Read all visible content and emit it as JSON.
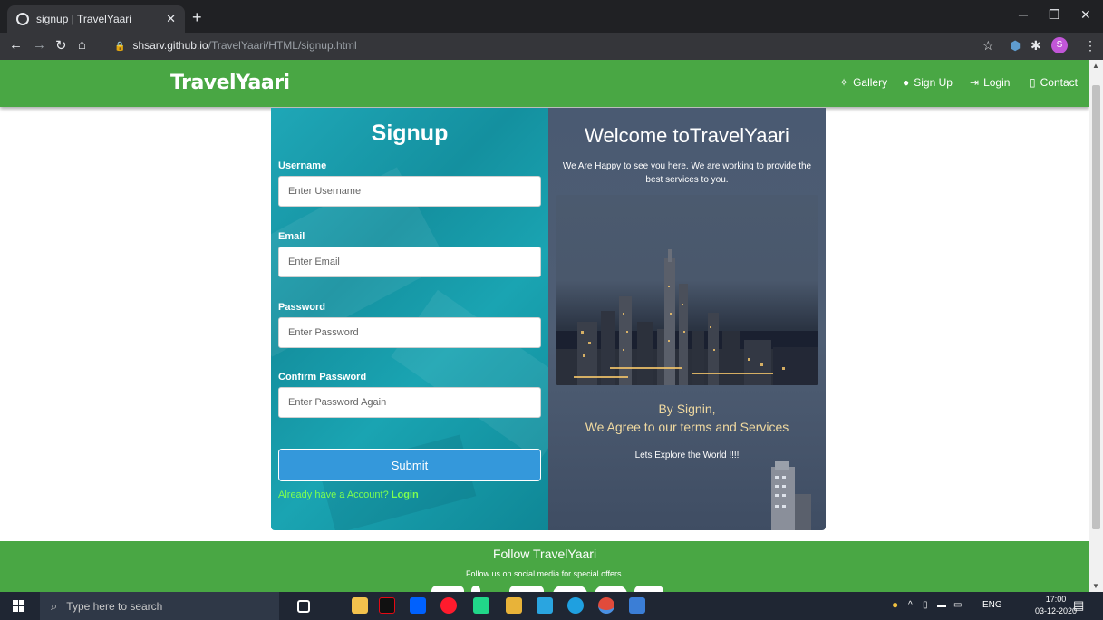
{
  "browser": {
    "tab_title": "signup | TravelYaari",
    "url_host": "shsarv.github.io",
    "url_path": "/TravelYaari/HTML/signup.html",
    "profile_initial": "S"
  },
  "site": {
    "brand": "TravelYaari",
    "nav": [
      {
        "label": "Gallery",
        "icon": "gallery-icon"
      },
      {
        "label": "Sign Up",
        "icon": "user-icon"
      },
      {
        "label": "Login",
        "icon": "login-icon"
      },
      {
        "label": "Contact",
        "icon": "phone-icon"
      }
    ]
  },
  "signup": {
    "title": "Signup",
    "username_label": "Username",
    "username_placeholder": "Enter Username",
    "email_label": "Email",
    "email_placeholder": "Enter Email",
    "password_label": "Password",
    "password_placeholder": "Enter Password",
    "confirm_label": "Confirm Password",
    "confirm_placeholder": "Enter Password Again",
    "submit_label": "Submit",
    "have_account_text": "Already have a Account?",
    "login_link": "Login"
  },
  "welcome": {
    "title": "Welcome toTravelYaari",
    "text": "We Are Happy to see you here. We are working to provide the best services to you.",
    "by_signin": "By Signin,",
    "agree": "We Agree to our terms and Services",
    "explore": "Lets Explore the World !!!!"
  },
  "footer": {
    "title": "Follow TravelYaari",
    "subtitle": "Follow us on social media for special offers."
  },
  "taskbar": {
    "search_placeholder": "Type here to search",
    "lang": "ENG",
    "time": "17:00",
    "date": "03-12-2020"
  },
  "colors": {
    "header_green": "#49a744",
    "signup_teal": "#1fa7b7",
    "welcome_slate": "#4a5a72",
    "submit_blue": "#3498db",
    "link_green": "#7dff4f"
  }
}
